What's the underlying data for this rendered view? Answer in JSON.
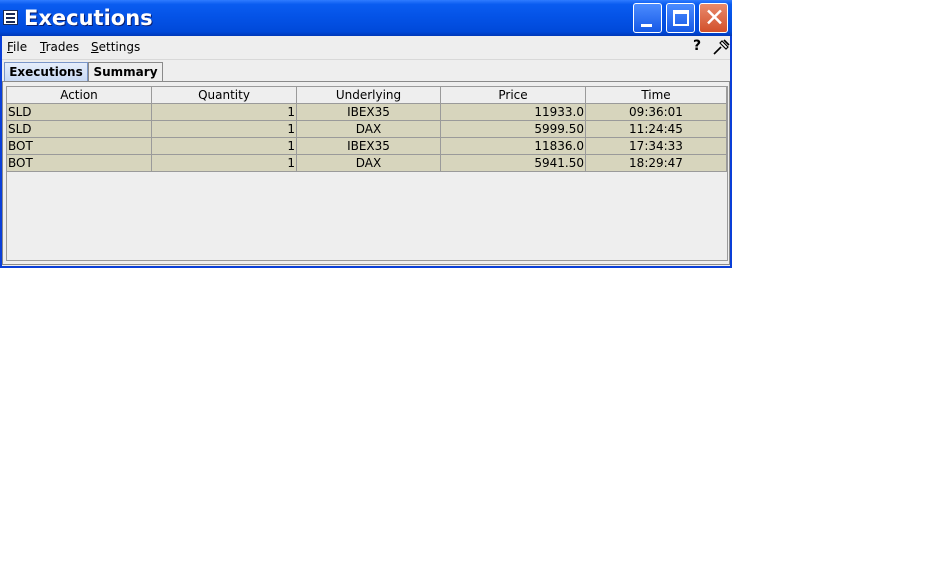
{
  "window": {
    "title": "Executions",
    "icons": {
      "app": "table-icon",
      "minimize": "minimize-icon",
      "maximize": "maximize-icon",
      "close": "close-icon"
    }
  },
  "menu": [
    {
      "label": "File",
      "mnemonic": "F",
      "rest": "ile"
    },
    {
      "label": "Trades",
      "mnemonic": "T",
      "rest": "rades"
    },
    {
      "label": "Settings",
      "mnemonic": "S",
      "rest": "ettings"
    }
  ],
  "toolbar_icons": {
    "help": "?",
    "pin": "pin-icon"
  },
  "tabs": [
    {
      "label": "Executions",
      "active": true
    },
    {
      "label": "Summary",
      "active": false
    }
  ],
  "table": {
    "columns": [
      "Action",
      "Quantity",
      "Underlying",
      "Price",
      "Time"
    ],
    "rows": [
      [
        "SLD",
        "1",
        "IBEX35",
        "11933.0",
        "09:36:01"
      ],
      [
        "SLD",
        "1",
        "DAX",
        "5999.50",
        "11:24:45"
      ],
      [
        "BOT",
        "1",
        "IBEX35",
        "11836.0",
        "17:34:33"
      ],
      [
        "BOT",
        "1",
        "DAX",
        "5941.50",
        "18:29:47"
      ]
    ]
  },
  "colors": {
    "titlebar": "#0452e6",
    "row_bg": "#d7d5bd",
    "client_bg": "#eeeeee",
    "close_btn": "#d2502a"
  }
}
